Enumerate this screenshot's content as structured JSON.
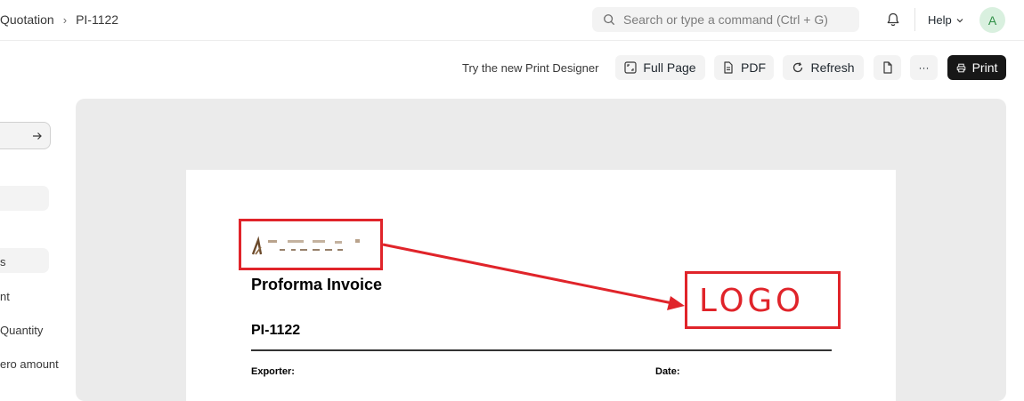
{
  "breadcrumb": {
    "doctype": "Quotation",
    "record": "PI-1122"
  },
  "search": {
    "placeholder": "Search or type a command (Ctrl + G)"
  },
  "nav": {
    "help": "Help",
    "avatar_initial": "A"
  },
  "toolbar": {
    "designer_text": "Try the new Print Designer",
    "full_page": "Full Page",
    "pdf": "PDF",
    "refresh": "Refresh",
    "more": "···",
    "print": "Print"
  },
  "sidebar": {
    "items": [
      "s",
      "nt",
      "Quantity",
      "ero amount"
    ]
  },
  "document": {
    "title": "Proforma Invoice",
    "id": "PI-1122",
    "exporter_label": "Exporter:",
    "date_label": "Date:"
  },
  "annotation": {
    "label": "LOGO",
    "color": "#e0242a"
  }
}
